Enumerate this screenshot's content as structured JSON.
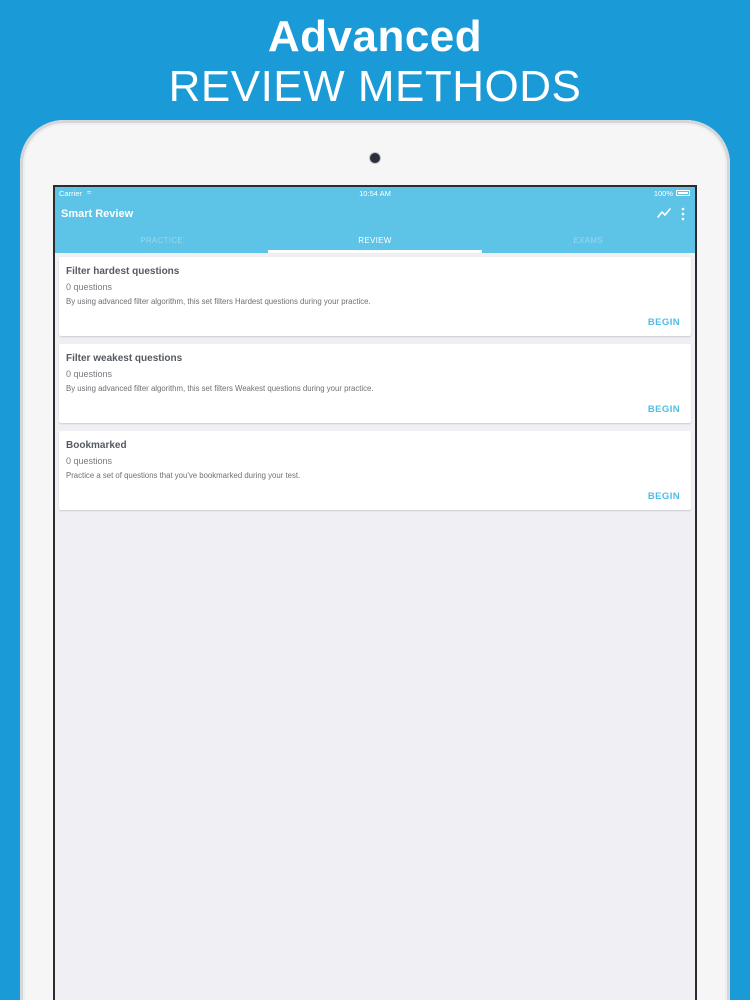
{
  "promo": {
    "line1": "Advanced",
    "line2": "REVIEW METHODS"
  },
  "statusbar": {
    "carrier": "Carrier",
    "time": "10:54 AM",
    "battery": "100%"
  },
  "appbar": {
    "title": "Smart Review",
    "actions": [
      "chart-icon",
      "more-vertical-icon"
    ]
  },
  "tabs": [
    {
      "label": "PRACTICE",
      "active": false
    },
    {
      "label": "REVIEW",
      "active": true
    },
    {
      "label": "EXAMS",
      "active": false
    }
  ],
  "cards": [
    {
      "title": "Filter hardest questions",
      "count": "0 questions",
      "description": "By using advanced filter algorithm, this set filters Hardest questions during your practice.",
      "action": "BEGIN"
    },
    {
      "title": "Filter weakest questions",
      "count": "0 questions",
      "description": "By using advanced filter algorithm, this set filters Weakest questions during your practice.",
      "action": "BEGIN"
    },
    {
      "title": "Bookmarked",
      "count": "0 questions",
      "description": "Practice a set of questions that you've bookmarked during your test.",
      "action": "BEGIN"
    }
  ],
  "colors": {
    "background": "#1a9ad6",
    "appbar": "#5ec4e7",
    "accent": "#4dbde6",
    "screen": "#efeff4"
  }
}
